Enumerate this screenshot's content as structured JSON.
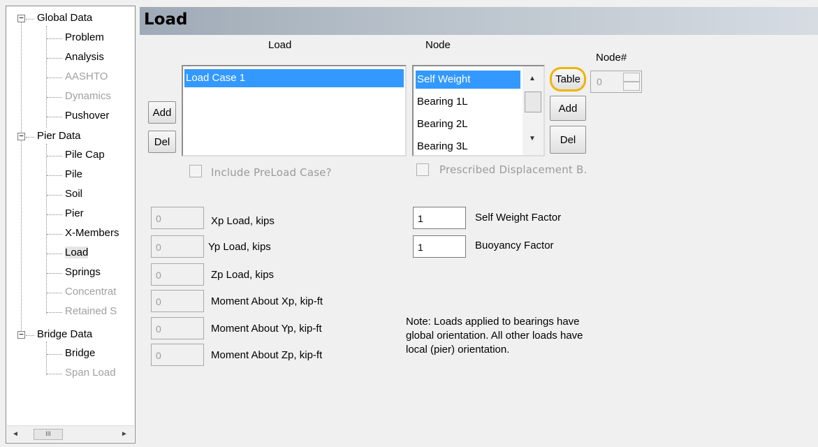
{
  "tree": {
    "items": [
      {
        "label": "Global Data"
      },
      {
        "label": "Problem"
      },
      {
        "label": "Analysis"
      },
      {
        "label": "AASHTO"
      },
      {
        "label": "Dynamics"
      },
      {
        "label": "Pushover"
      },
      {
        "label": "Pier Data"
      },
      {
        "label": "Pile Cap"
      },
      {
        "label": "Pile"
      },
      {
        "label": "Soil"
      },
      {
        "label": "Pier"
      },
      {
        "label": "X-Members"
      },
      {
        "label": "Load"
      },
      {
        "label": "Springs"
      },
      {
        "label": "Concentrat"
      },
      {
        "label": "Retained S"
      },
      {
        "label": "Bridge Data"
      },
      {
        "label": "Bridge"
      },
      {
        "label": "Span Load"
      }
    ],
    "expander": "−",
    "scroll_left": "◄",
    "scroll_right": "►",
    "scroll_thumb": "III"
  },
  "header": {
    "title": "Load"
  },
  "load": {
    "column_label": "Load",
    "add_label": "Add",
    "del_label": "Del",
    "items": [
      "Load Case 1"
    ]
  },
  "node": {
    "column_label": "Node",
    "items": [
      "Self Weight",
      "Bearing 1L",
      "Bearing 2L",
      "Bearing 3L"
    ],
    "scroll_up": "▲",
    "scroll_down": "▼",
    "table_label": "Table",
    "add_label": "Add",
    "del_label": "Del",
    "nodenum_label": "Node#",
    "nodenum_value": "0",
    "highlight_color": "#f0b400"
  },
  "checks": {
    "preload": "Include PreLoad Case?",
    "prescribed": "Prescribed Displacement B."
  },
  "fields": [
    {
      "label": "Xp Load, kips",
      "value": "0"
    },
    {
      "label": "Yp Load, kips",
      "value": "0"
    },
    {
      "label": "Zp Load, kips",
      "value": "0"
    },
    {
      "label": "Moment About Xp, kip-ft",
      "value": "0"
    },
    {
      "label": "Moment About Yp, kip-ft",
      "value": "0"
    },
    {
      "label": "Moment About Zp, kip-ft",
      "value": "0"
    }
  ],
  "factors": [
    {
      "label": "Self Weight Factor",
      "value": "1"
    },
    {
      "label": "Buoyancy Factor",
      "value": "1"
    }
  ],
  "note": {
    "line1": "Note: Loads applied to bearings have",
    "line2": "global orientation.  All other loads have",
    "line3": "local (pier) orientation."
  }
}
